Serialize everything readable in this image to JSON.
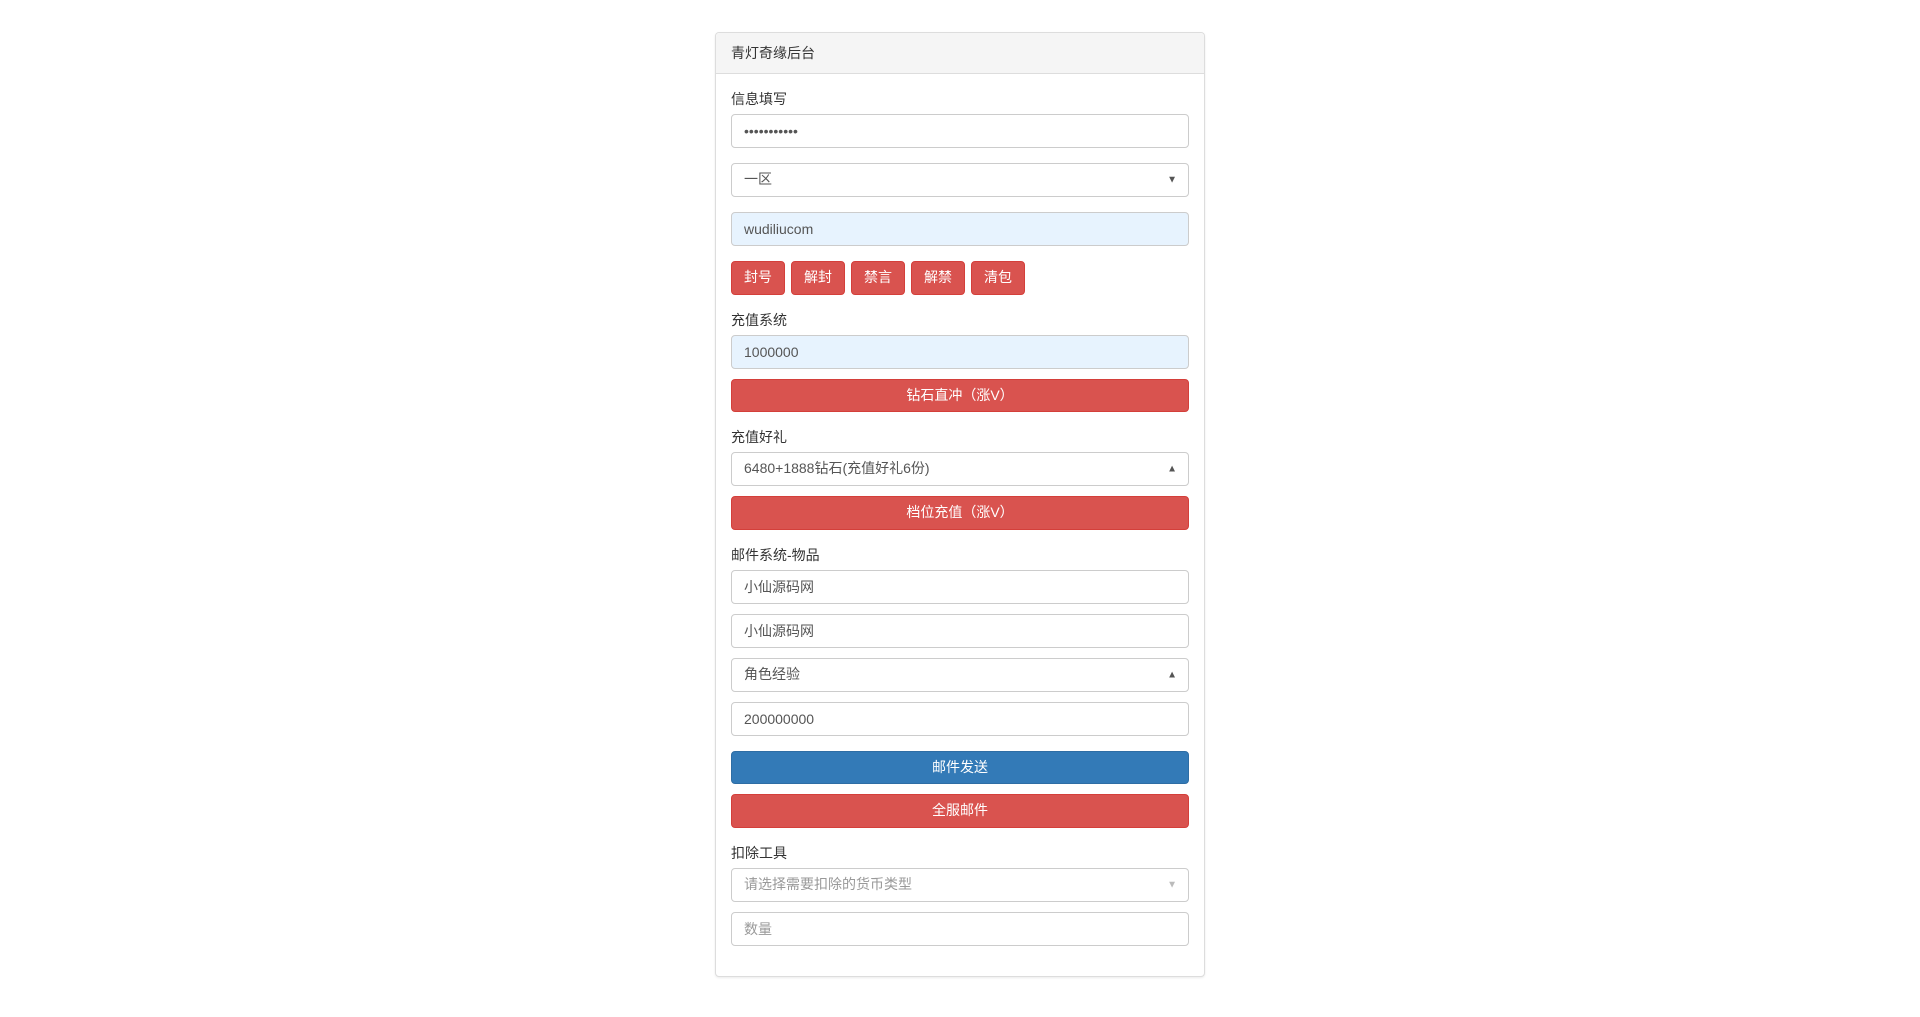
{
  "panel": {
    "title": "青灯奇缘后台"
  },
  "info": {
    "label": "信息填写",
    "password_mask": "●●●●●●●●●●●",
    "region_selected": "一区",
    "account_value": "wudiliucom"
  },
  "account_actions": {
    "ban": "封号",
    "unban": "解封",
    "mute": "禁言",
    "unmute": "解禁",
    "clearbag": "清包"
  },
  "recharge": {
    "label": "充值系统",
    "amount_value": "1000000",
    "diamond_button": "钻石直冲（涨V）"
  },
  "gift": {
    "label": "充值好礼",
    "selected": "6480+1888钻石(充值好礼6份)",
    "tier_button": "档位充值（涨V）"
  },
  "mail": {
    "label": "邮件系统-物品",
    "title_value": "小仙源码网",
    "content_value": "小仙源码网",
    "item_selected": "角色经验",
    "quantity_value": "200000000",
    "send_button": "邮件发送",
    "broadcast_button": "全服邮件"
  },
  "deduct": {
    "label": "扣除工具",
    "currency_placeholder": "请选择需要扣除的货币类型",
    "quantity_placeholder": "数量"
  }
}
